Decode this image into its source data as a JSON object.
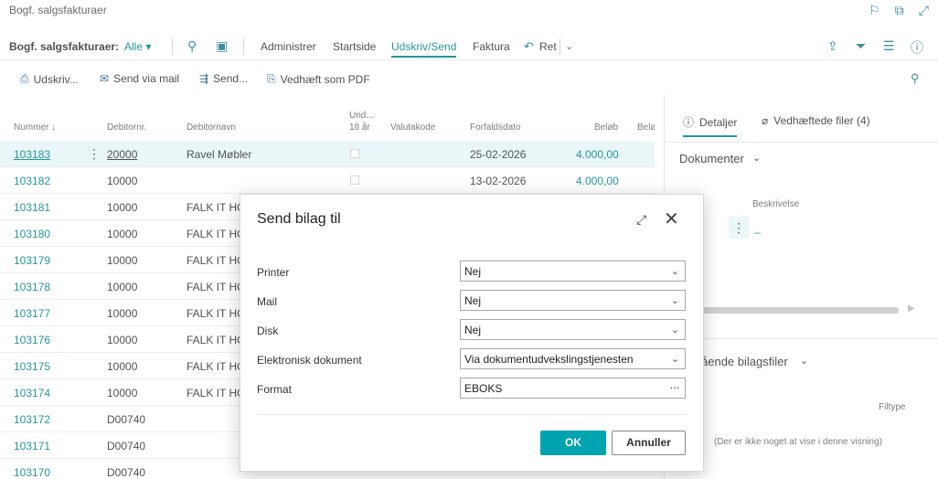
{
  "page": {
    "title": "Bogf. salgsfakturaer"
  },
  "actionbar": {
    "title": "Bogf. salgsfakturaer:",
    "filter": "Alle ▾",
    "items": [
      "Administrer",
      "Startside",
      "Udskriv/Send",
      "Faktura",
      "Ret"
    ],
    "active": "Udskriv/Send"
  },
  "subbar": {
    "items": [
      "Udskriv...",
      "Send via mail",
      "Send...",
      "Vedhæft som PDF"
    ]
  },
  "list": {
    "headers": {
      "nummer": "Nummer ↓",
      "debitornr": "Debitornr.",
      "debitornavn": "Debitornavn",
      "und1": "Und...",
      "und2": "18 år",
      "valutakode": "Valutakode",
      "forfaldsdato": "Forfaldsdato",
      "belob": "Beløb",
      "bela": "Belø"
    },
    "rows": [
      {
        "nummer": "103183",
        "debitor": "20000",
        "navn": "Ravel Møbler",
        "dato": "25-02-2026",
        "belob": "4.000,00"
      },
      {
        "nummer": "103182",
        "debitor": "10000",
        "navn": "",
        "dato": "13-02-2026",
        "belob": "4.000,00"
      },
      {
        "nummer": "103181",
        "debitor": "10000",
        "navn": "FALK IT HO",
        "dato": "",
        "belob": ""
      },
      {
        "nummer": "103180",
        "debitor": "10000",
        "navn": "FALK IT HO",
        "dato": "",
        "belob": ""
      },
      {
        "nummer": "103179",
        "debitor": "10000",
        "navn": "FALK IT HO",
        "dato": "",
        "belob": ""
      },
      {
        "nummer": "103178",
        "debitor": "10000",
        "navn": "FALK IT HO",
        "dato": "",
        "belob": ""
      },
      {
        "nummer": "103177",
        "debitor": "10000",
        "navn": "FALK IT HO",
        "dato": "",
        "belob": ""
      },
      {
        "nummer": "103176",
        "debitor": "10000",
        "navn": "FALK IT HO",
        "dato": "",
        "belob": ""
      },
      {
        "nummer": "103175",
        "debitor": "10000",
        "navn": "FALK IT HO",
        "dato": "",
        "belob": ""
      },
      {
        "nummer": "103174",
        "debitor": "10000",
        "navn": "FALK IT HO",
        "dato": "",
        "belob": ""
      },
      {
        "nummer": "103172",
        "debitor": "D00740",
        "navn": "",
        "dato": "",
        "belob": ""
      },
      {
        "nummer": "103171",
        "debitor": "D00740",
        "navn": "",
        "dato": "",
        "belob": ""
      },
      {
        "nummer": "103170",
        "debitor": "D00740",
        "navn": "",
        "dato": "",
        "belob": ""
      }
    ]
  },
  "factbox": {
    "tab_details": "Detaljer",
    "tab_attachments": "Vedhæftede filer (4)",
    "section_documents": "Dokumenter",
    "col_description": "Beskrivelse",
    "dash": "_",
    "section_incoming": "ående bilagsfiler",
    "col_filetype": "Filtype",
    "empty": "(Der er ikke noget at vise i denne visning)"
  },
  "dialog": {
    "title": "Send bilag til",
    "fields": [
      {
        "label": "Printer",
        "value": "Nej"
      },
      {
        "label": "Mail",
        "value": "Nej"
      },
      {
        "label": "Disk",
        "value": "Nej"
      },
      {
        "label": "Elektronisk dokument",
        "value": "Via dokumentudvekslingstjenesten"
      },
      {
        "label": "Format",
        "value": "EBOKS"
      }
    ],
    "ok": "OK",
    "cancel": "Annuller"
  },
  "colors": {
    "accent": "#008489",
    "button": "#00a3b0"
  }
}
